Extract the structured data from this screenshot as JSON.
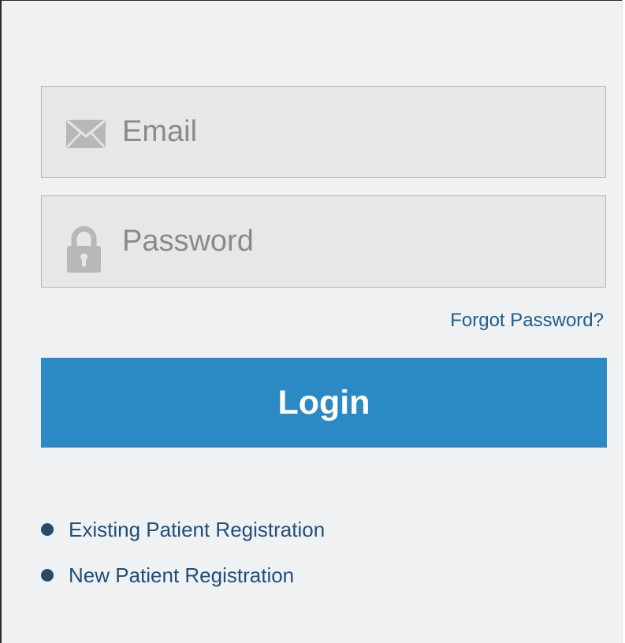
{
  "login_form": {
    "email": {
      "placeholder": "Email",
      "value": "",
      "icon": "envelope-icon"
    },
    "password": {
      "placeholder": "Password",
      "value": "",
      "icon": "lock-icon"
    },
    "forgot_password_label": "Forgot Password?",
    "login_label": "Login"
  },
  "registration_links": [
    {
      "label": "Existing Patient Registration"
    },
    {
      "label": "New Patient Registration"
    }
  ],
  "colors": {
    "panel_background": "#f0f1f3",
    "field_background": "#e6e7e9",
    "field_border": "#b3b4b6",
    "icon_gray": "#b7b8ba",
    "primary_button": "#2b8ac3",
    "link_color": "#1f5f8b",
    "bullet_color": "#264c6b"
  }
}
